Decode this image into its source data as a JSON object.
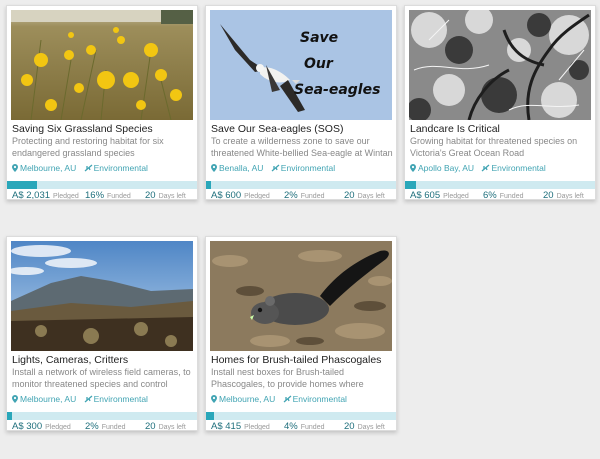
{
  "labels": {
    "pledged": "Pledged",
    "funded": "Funded",
    "days": "Days left"
  },
  "colors": {
    "accent": "#2aa7ba",
    "bar_bg": "#cfeaf0",
    "meta": "#41a4b3"
  },
  "cards": [
    {
      "title": "Saving Six Grassland Species",
      "desc": "Protecting and restoring habitat for six endangered grassland species",
      "location": "Melbourne, AU",
      "category": "Environmental",
      "pledged": "A$ 2,031",
      "funded_pct": "16%",
      "funded_fraction": 0.16,
      "days": "20"
    },
    {
      "title": "Save Our Sea-eagles (SOS)",
      "desc": "To create a wilderness zone to save our threatened White-bellied Sea-eagle at Wintan",
      "location": "Benalla, AU",
      "category": "Environmental",
      "pledged": "A$ 600",
      "funded_pct": "2%",
      "funded_fraction": 0.02,
      "days": "20",
      "image_text": [
        "Save",
        "Our",
        "Sea-eagles"
      ]
    },
    {
      "title": "Landcare Is Critical",
      "desc": "Growing habitat for threatened species on Victoria's Great Ocean Road",
      "location": "Apollo Bay, AU",
      "category": "Environmental",
      "pledged": "A$ 605",
      "funded_pct": "6%",
      "funded_fraction": 0.06,
      "days": "20"
    },
    {
      "title": "Lights, Cameras, Critters",
      "desc": "Install a network of wireless field cameras, to monitor threatened species and control ferals.",
      "location": "Melbourne, AU",
      "category": "Environmental",
      "pledged": "A$ 300",
      "funded_pct": "2%",
      "funded_fraction": 0.02,
      "days": "20"
    },
    {
      "title": "Homes for Brush-tailed Phascogales",
      "desc": "Install nest boxes for Brush-tailed Phascogales, to provide homes where",
      "location": "Melbourne, AU",
      "category": "Environmental",
      "pledged": "A$ 415",
      "funded_pct": "4%",
      "funded_fraction": 0.04,
      "days": "20"
    }
  ]
}
